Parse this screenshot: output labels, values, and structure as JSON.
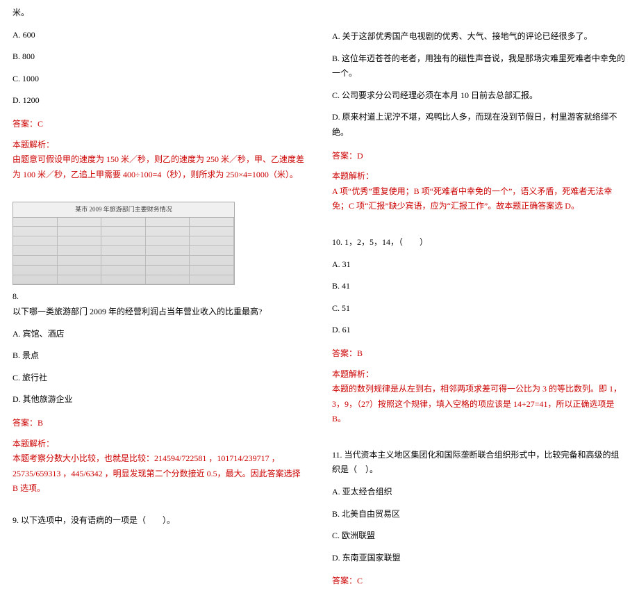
{
  "left": {
    "q7_tail": {
      "stem_tail": "米。",
      "options": {
        "a": "A. 600",
        "b": "B. 800",
        "c": "C. 1000",
        "d": "D. 1200"
      },
      "answer": "答案：C",
      "analysis_label": "本题解析：",
      "analysis_text": "由题意可假设甲的速度为 150 米／秒，则乙的速度为 250 米／秒，甲、乙速度差为 100 米／秒，乙追上甲需要 400÷100=4（秒），则所求为 250×4=1000（米）。"
    },
    "q8": {
      "number": "8.",
      "table_title": "某市 2009 年旅游部门主要财务情况",
      "stem": "以下哪一类旅游部门 2009 年的经营利润占当年营业收入的比重最高?",
      "options": {
        "a": "A. 宾馆、酒店",
        "b": "B. 景点",
        "c": "C. 旅行社",
        "d": "D. 其他旅游企业"
      },
      "answer": "答案：B",
      "analysis_label": "本题解析：",
      "analysis_text": "本题考察分数大小比较，也就是比较：214594/722581 ，101714/239717 ，25735/659313 ，445/6342 ，明显发现第二个分数接近 0.5，最大。因此答案选择 B 选项。"
    },
    "q9": {
      "stem": "9. 以下选项中，没有语病的一项是（　　）。"
    }
  },
  "right": {
    "q9_options": {
      "a": "A. 关于这部优秀国产电视剧的优秀、大气、接地气的评论已经很多了。",
      "b": "B. 这位年迈苍苍的老者，用独有的磁性声音说，我是那场灾难里死难者中幸免的一个。",
      "c": "C. 公司要求分公司经理必须在本月 10 日前去总部汇报。",
      "d": "D. 原来村道上泥泞不堪，鸡鸭比人多，而现在没到节假日，村里游客就络绎不绝。"
    },
    "q9_answer": "答案：D",
    "q9_analysis_label": "本题解析：",
    "q9_analysis_text": "A 项“优秀”重复使用；B 项“死难者中幸免的一个”，语义矛盾，死难者无法幸免；C 项“汇报”缺少宾语，应为“汇报工作”。故本题正确答案选 D。",
    "q10": {
      "stem": "10. 1，2，5，14，（　　）",
      "options": {
        "a": "A. 31",
        "b": "B. 41",
        "c": "C. 51",
        "d": "D. 61"
      },
      "answer": "答案：B",
      "analysis_label": "本题解析：",
      "analysis_text": "本题的数列规律是从左到右，相邻两项求差可得一公比为 3 的等比数列。即 1，3，9，（27）按照这个规律，填入空格的项应该是 14+27=41，所以正确选项是 B。"
    },
    "q11": {
      "stem": "11. 当代资本主义地区集团化和国际垄断联合组织形式中，比较完备和高级的组织是（　）。",
      "options": {
        "a": "A. 亚太经合组织",
        "b": "B. 北美自由贸易区",
        "c": "C. 欧洲联盟",
        "d": "D. 东南亚国家联盟"
      },
      "answer": "答案：C"
    }
  }
}
